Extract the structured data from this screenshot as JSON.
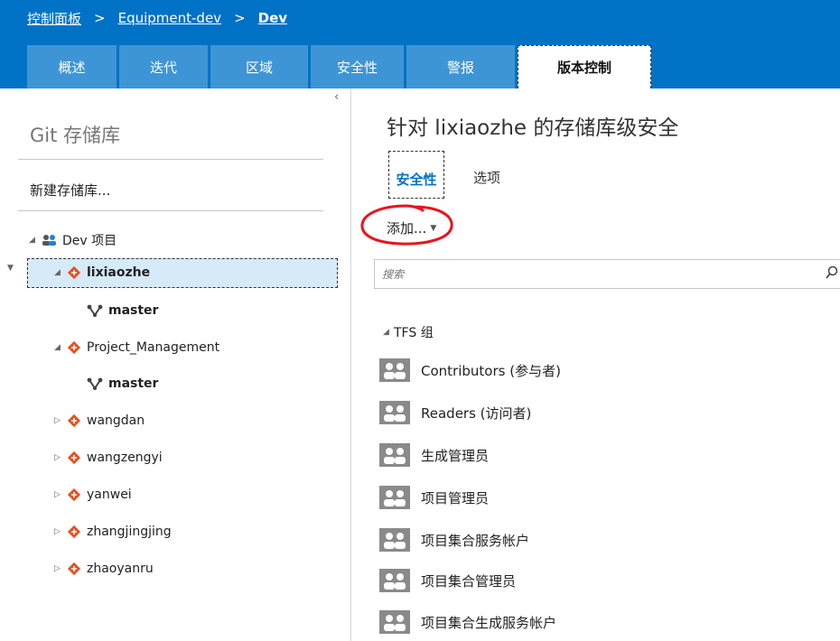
{
  "breadcrumb": {
    "items": [
      "控制面板",
      "Equipment-dev",
      "Dev"
    ],
    "separator": ">"
  },
  "tabs": [
    {
      "label": "概述",
      "active": false
    },
    {
      "label": "迭代",
      "active": false
    },
    {
      "label": "区域",
      "active": false
    },
    {
      "label": "安全性",
      "active": false
    },
    {
      "label": "警报",
      "active": false
    },
    {
      "label": "版本控制",
      "active": true
    }
  ],
  "left_pane": {
    "title": "Git 存储库",
    "new_repo_label": "新建存储库...",
    "collapse_glyph": "‹",
    "tree": [
      {
        "label": "Dev 项目",
        "icon": "team-project-icon",
        "expanded": true
      },
      {
        "label": "lixiaozhe",
        "icon": "git-repo-icon",
        "expanded": true,
        "selected": true
      },
      {
        "label": "master",
        "icon": "branch-icon"
      },
      {
        "label": "Project_Management",
        "icon": "git-repo-icon",
        "expanded": true
      },
      {
        "label": "master",
        "icon": "branch-icon"
      },
      {
        "label": "wangdan",
        "icon": "git-repo-icon",
        "expanded": false
      },
      {
        "label": "wangzengyi",
        "icon": "git-repo-icon",
        "expanded": false
      },
      {
        "label": "yanwei",
        "icon": "git-repo-icon",
        "expanded": false
      },
      {
        "label": "zhangjingjing",
        "icon": "git-repo-icon",
        "expanded": false
      },
      {
        "label": "zhaoyanru",
        "icon": "git-repo-icon",
        "expanded": false
      }
    ]
  },
  "main": {
    "title": "针对 lixiaozhe 的存储库级安全",
    "subtabs": [
      {
        "label": "安全性",
        "active": true
      },
      {
        "label": "选项",
        "active": false
      }
    ],
    "add_label": "添加...",
    "search": {
      "placeholder": "搜索",
      "value": ""
    },
    "group_header": "TFS 组",
    "groups": [
      "Contributors (参与者)",
      "Readers (访问者)",
      "生成管理员",
      "项目管理员",
      "项目集合服务帐户",
      "项目集合管理员",
      "项目集合生成服务帐户"
    ]
  },
  "colors": {
    "accent": "#0072c6",
    "tab_inactive": "#3e95d6",
    "selection": "#d6eaf8",
    "git_icon": "#e8501e",
    "annotation": "#e8141c",
    "group_icon": "#8a8a8a"
  }
}
